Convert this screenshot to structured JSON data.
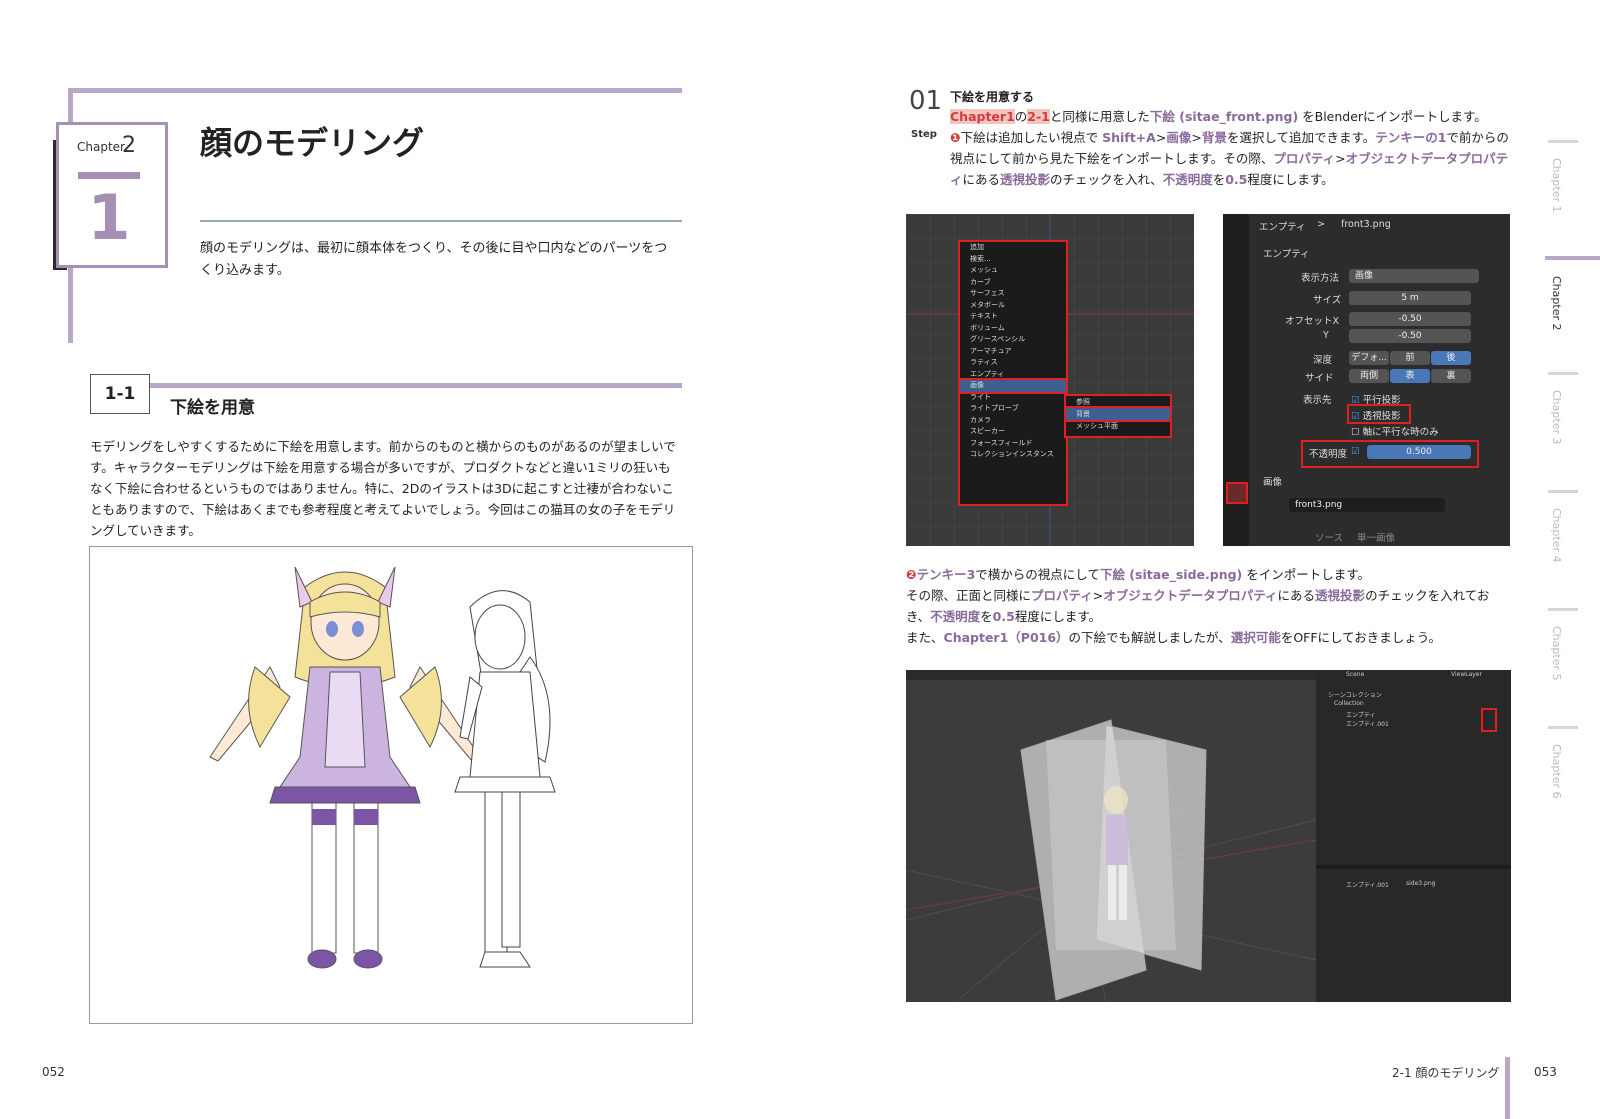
{
  "left_page": {
    "chapter_label": "Chapter",
    "chapter_number": "2",
    "section_number_big": "1",
    "title": "顔のモデリング",
    "lead": "顔のモデリングは、最初に顔本体をつくり、その後に目や口内などのパーツをつくり込みます。",
    "section": {
      "number": "1-1",
      "title": "下絵を用意"
    },
    "body": "モデリングをしやすくするために下絵を用意します。前からのものと横からのものがあるのが望ましいです。キャラクターモデリングは下絵を用意する場合が多いですが、プロダクトなどと違い1ミリの狂いもなく下絵に合わせるというものではありません。特に、2Dのイラストは3Dに起こすと辻褄が合わないこともありますので、下絵はあくまでも参考程度と考えてよいでしょう。今回はこの猫耳の女の子をモデリングしていきます。",
    "page_number": "052"
  },
  "right_page": {
    "step_number": "01",
    "step_label": "Step",
    "step_title": "下絵を用意する",
    "p1_parts": {
      "a": "Chapter1",
      "b": "の",
      "c": "2-1",
      "d": "と同様に用意した",
      "e": "下絵 (sitae_front.png)",
      "f": " をBlenderにインポートします。"
    },
    "p2_parts": {
      "num": "❶",
      "a": "下絵は追加したい視点で ",
      "b": "Shift+A",
      "c": ">",
      "d": "画像",
      "e": ">",
      "f": "背景",
      "g": "を選択して追加できます。",
      "h": "テンキーの1",
      "i": "で前からの視点にして前から見た下絵をインポートします。その際、",
      "j": "プロパティ",
      "k": ">",
      "l": "オブジェクトデータプロパティ",
      "m": "にある",
      "n": "透視投影",
      "o": "のチェックを入れ、",
      "p": "不透明度",
      "q": "を",
      "r": "0.5",
      "s": "程度にします。"
    },
    "p3_parts": {
      "num": "❷",
      "a": "テンキー3",
      "b": "で横からの視点にして",
      "c": "下絵 (sitae_side.png)",
      "d": " をインポートします。"
    },
    "p4_parts": {
      "a": "その際、正面と同様に",
      "b": "プロパティ",
      "c": ">",
      "d": "オブジェクトデータプロパティ",
      "e": "にある",
      "f": "透視投影",
      "g": "のチェックを入れておき、",
      "h": "不透明度",
      "i": "を",
      "j": "0.5",
      "k": "程度にします。"
    },
    "p5_parts": {
      "a": "また、",
      "b": "Chapter1（P016）",
      "c": "の下絵でも解説しましたが、",
      "d": "選択可能",
      "e": "をOFFにしておきましょう。"
    },
    "footer_title": "2-1 顔のモデリング",
    "page_number": "053",
    "chapter_tabs": [
      {
        "label": "Chapter",
        "num": "1"
      },
      {
        "label": "Chapter",
        "num": "2"
      },
      {
        "label": "Chapter",
        "num": "3"
      },
      {
        "label": "Chapter",
        "num": "4"
      },
      {
        "label": "Chapter",
        "num": "5"
      },
      {
        "label": "Chapter",
        "num": "6"
      }
    ]
  },
  "add_menu": {
    "header": "追加",
    "search": "検索...",
    "items": [
      "メッシュ",
      "カーブ",
      "サーフェス",
      "メタボール",
      "テキスト",
      "ボリューム",
      "グリースペンシル",
      "アーマチュア",
      "ラティス",
      "エンプティ",
      "画像",
      "ライト",
      "ライトプローブ",
      "カメラ",
      "スピーカー",
      "フォースフィールド",
      "コレクションインスタンス"
    ],
    "submenu": [
      "参照",
      "背景",
      "メッシュ平面"
    ]
  },
  "props_panel": {
    "breadcrumb_a": "エンプティ",
    "breadcrumb_sep": ">",
    "breadcrumb_b": "front3.png",
    "section": "エンプティ",
    "display_label": "表示方法",
    "display_value": "画像",
    "size_label": "サイズ",
    "size_value": "5 m",
    "offset_x_label": "オフセットX",
    "offset_x_value": "-0.50",
    "offset_y_label": "Y",
    "offset_y_value": "-0.50",
    "depth_label": "深度",
    "depth_opts": [
      "デフォ...",
      "前",
      "後"
    ],
    "side_label": "サイド",
    "side_opts": [
      "両側",
      "表",
      "裏"
    ],
    "show_label": "表示先",
    "check_ortho": "平行投影",
    "check_persp": "透視投影",
    "check_axis": "軸に平行な時のみ",
    "opacity_label": "不透明度",
    "opacity_value": "0.500",
    "image_section": "画像",
    "image_name": "front3.png",
    "source_label": "ソース",
    "source_value": "単一画像"
  },
  "outliner": {
    "scene": "Scene",
    "view_layer": "ViewLayer",
    "scene_collection": "シーンコレクション",
    "collection": "Collection",
    "item1": "エンプティ",
    "item2": "エンプティ.001",
    "props_a": "エンプティ.001",
    "props_b": "side3.png"
  },
  "colors": {
    "accent": "#b9a9c6",
    "accent_dark": "#8a6a9b",
    "highlight_red": "#e02020"
  }
}
